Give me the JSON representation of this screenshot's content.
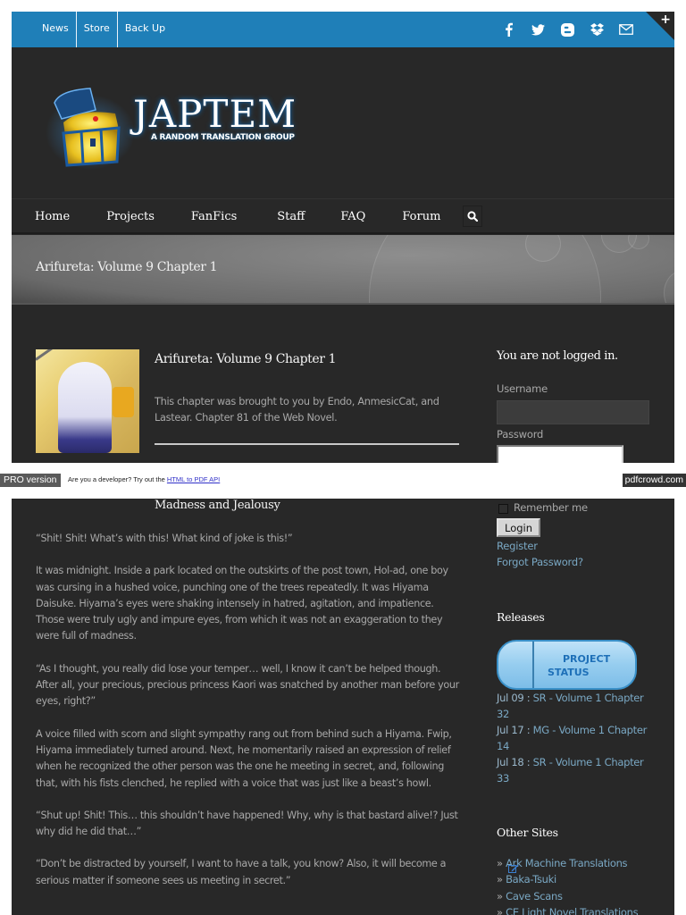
{
  "topbar": {
    "links": [
      "News",
      "Store",
      "Back Up"
    ],
    "social_icons": [
      "facebook-icon",
      "twitter-icon",
      "blogger-icon",
      "dropbox-icon",
      "mail-icon"
    ],
    "corner_label": "+",
    "accent_color": "#1f7fb8"
  },
  "logo": {
    "title": "JAPTEM",
    "subtitle": "A RANDOM TRANSLATION GROUP"
  },
  "mainnav": {
    "items": [
      "Home",
      "Projects",
      "FanFics",
      "Staff",
      "FAQ",
      "Forum"
    ],
    "search_icon": "search-icon"
  },
  "banner": {
    "title": "Arifureta: Volume 9 Chapter 1"
  },
  "post": {
    "title": "Arifureta: Volume 9 Chapter 1",
    "description": "This chapter was brought to you by Endo, AnmesicCat, and Lastear. Chapter 81 of the Web Novel.",
    "chapter_heading": "Madness and Jealousy",
    "paragraphs": [
      "“Shit! Shit! What’s with this! What kind of joke is this!”",
      "It was midnight. Inside a park located on the outskirts of the post town, Hol-ad, one boy was cursing in a hushed voice, punching one of the trees repeatedly. It was Hiyama Daisuke. Hiyama’s eyes were shaking intensely in hatred, agitation, and impatience. Those were truly ugly and impure eyes, from which it was not an exaggeration to they were full of madness.",
      "“As I thought, you really did lose your temper… well, I know it can’t be helped though. After all, your precious, precious princess Kaori was snatched by another man before your eyes, right?”",
      "A voice filled with scorn and slight sympathy rang out from behind such a Hiyama. Fwip, Hiyama immediately turned around. Next, he momentarily raised an expression of relief when he recognized the other person was the one he meeting in secret, and, following that, with his fists clenched, he replied with a voice that was just like a beast’s howl.",
      "“Shut up! Shit! This… this shouldn’t have happened! Why, why is that bastard alive!? Just why did he did that…”",
      "“Don’t be distracted by yourself, I want to have a talk, you know? Also, it will become a serious matter if someone sees us meeting in secret.”"
    ]
  },
  "login": {
    "heading": "You are not logged in.",
    "username_label": "Username",
    "username_value": "",
    "password_label": "Password",
    "password_value": "",
    "remember_label": "Remember me",
    "remember_checked": false,
    "login_button": "Login",
    "register_link": "Register",
    "forgot_link": "Forgot Password?"
  },
  "releases": {
    "heading": "Releases",
    "status_button_line1": "PROJECT",
    "status_button_line2": "STATUS",
    "items": [
      {
        "date": "Jul 09 :",
        "text": " SR - Volume 1 Chapter 32"
      },
      {
        "date": "Jul 17 :",
        "text": " MG - Volume 1 Chapter 14"
      },
      {
        "date": "Jul 18 :",
        "text": " SR - Volume 1 Chapter 33"
      }
    ]
  },
  "other_sites": {
    "heading": "Other Sites",
    "prefix": "» ",
    "items": [
      "Ark Machine Translations",
      "Baka-Tsuki",
      "Cave Scans",
      "CE Light Novel Translations"
    ]
  },
  "pdf_banner": {
    "pro_label": "PRO version",
    "dev_text": "Are you a developer? Try out the ",
    "api_link": "HTML to PDF API",
    "brand": "pdfcrowd.com"
  }
}
